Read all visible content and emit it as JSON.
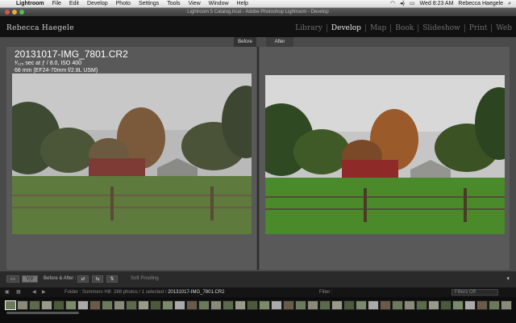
{
  "menubar": {
    "app": "Lightroom",
    "items": [
      "Lightroom",
      "File",
      "Edit",
      "Develop",
      "Photo",
      "Settings",
      "Tools",
      "View",
      "Window",
      "Help"
    ],
    "clock": "Wed 8:23 AM",
    "user": "Rebecca Haegele"
  },
  "window": {
    "title": "Lightroom 5 Catalog.lrcat - Adobe Photoshop Lightroom - Develop"
  },
  "identity_plate": "Rebecca Haegele",
  "modules": [
    {
      "label": "Library",
      "active": false
    },
    {
      "label": "Develop",
      "active": true
    },
    {
      "label": "Map",
      "active": false
    },
    {
      "label": "Book",
      "active": false
    },
    {
      "label": "Slideshow",
      "active": false
    },
    {
      "label": "Print",
      "active": false
    },
    {
      "label": "Web",
      "active": false
    }
  ],
  "view": {
    "before_label": "Before",
    "after_label": "After"
  },
  "info_overlay": {
    "filename": "20131017-IMG_7801.CR2",
    "exposure": "¹⁄₁₂₅ sec at ƒ / 8.0, ISO 400",
    "lens": "68 mm (EF24-70mm f/2.8L USM)"
  },
  "toolbar": {
    "before_after_label": "Before & After :",
    "soft_proofing_label": "Soft Proofing",
    "view_mode": "Y|Y"
  },
  "filmstrip_header": {
    "folder": "Folder : Sommers Hill",
    "count": "288 photos / 1 selected /",
    "selected_file": "20131017-IMG_7801.CR2",
    "filter_label": "Filter :",
    "filter_value": "Filters Off"
  },
  "colors": {
    "accent_active": "#e8e8e8",
    "panel_bg": "#4a4a4a",
    "chrome_bg": "#111111"
  }
}
